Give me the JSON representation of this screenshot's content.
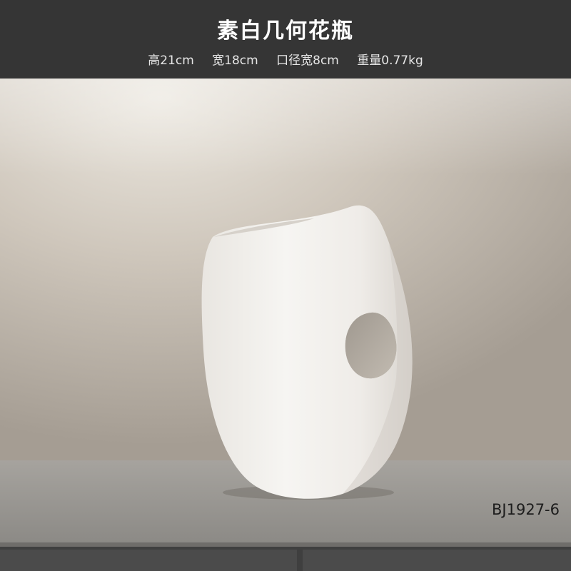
{
  "header": {
    "title": "素白几何花瓶",
    "specs": {
      "height": "高21cm",
      "width": "宽18cm",
      "opening": "口径宽8cm",
      "weight": "重量0.77kg"
    }
  },
  "product": {
    "code": "BJ1927-6"
  },
  "colors": {
    "header_bg": "#353535",
    "wall": "#c9c2b8",
    "shelf": "#8f8d89",
    "cabinet": "#4a4a4a",
    "vase": "#f1efec"
  }
}
